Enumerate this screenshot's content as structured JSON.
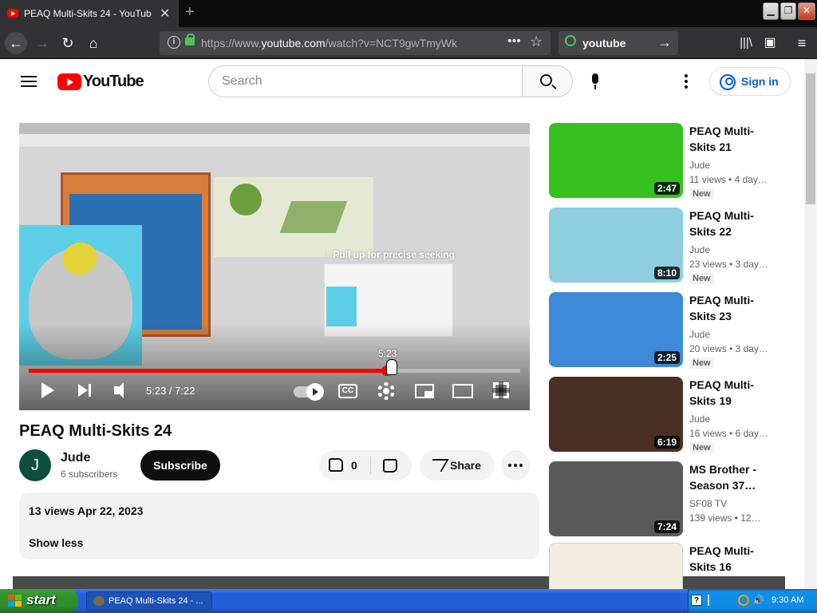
{
  "browser": {
    "tab_title": "PEAQ Multi-Skits 24 - YouTube",
    "url_prefix": "https://www.",
    "url_domain": "youtube.com",
    "url_path": "/watch?v=NCT9gwTmyWk",
    "search_query": "youtube"
  },
  "masthead": {
    "logo_text": "YouTube",
    "search_placeholder": "Search",
    "signin_label": "Sign in"
  },
  "player": {
    "overlay_hint": "↑ Pull up for precise seeking",
    "scrub_time": "5:23",
    "time_display": "5:23 / 7:22",
    "cc_label": "CC",
    "progress_fraction": 0.727,
    "colors": {
      "progress": "#ff0000"
    }
  },
  "video": {
    "title": "PEAQ Multi-Skits 24",
    "channel_initial": "J",
    "channel_name": "Jude",
    "subscribers": "6 subscribers",
    "subscribe_label": "Subscribe",
    "like_count": "0",
    "share_label": "Share",
    "description_stats": "13 views  Apr 22, 2023",
    "show_less": "Show less"
  },
  "related": [
    {
      "title": "PEAQ Multi-Skits 21",
      "channel": "Jude",
      "meta": "11 views • 4 day…",
      "badge": "New",
      "duration": "2:47",
      "color": "#35c21f"
    },
    {
      "title": "PEAQ Multi-Skits 22",
      "channel": "Jude",
      "meta": "23 views • 3 day…",
      "badge": "New",
      "duration": "8:10",
      "color": "#8fcde0"
    },
    {
      "title": "PEAQ Multi-Skits 23",
      "channel": "Jude",
      "meta": "20 views • 3 day…",
      "badge": "New",
      "duration": "2:25",
      "color": "#3d8ad9"
    },
    {
      "title": "PEAQ Multi-Skits 19",
      "channel": "Jude",
      "meta": "16 views • 6 day…",
      "badge": "New",
      "duration": "6:19",
      "color": "#4a2f24"
    },
    {
      "title": "MS Brother - Season 37…",
      "channel": "SF08 TV",
      "meta": "139 views • 12…",
      "badge": "",
      "duration": "7:24",
      "color": "#5a5a5a"
    },
    {
      "title": "PEAQ Multi-Skits 16",
      "channel": "",
      "meta": "",
      "badge": "",
      "duration": "",
      "color": "#f3ede0"
    }
  ],
  "taskbar": {
    "start_label": "start",
    "task_label": "PEAQ Multi-Skits 24 - ...",
    "help_label": "?",
    "clock": "9:30 AM"
  }
}
